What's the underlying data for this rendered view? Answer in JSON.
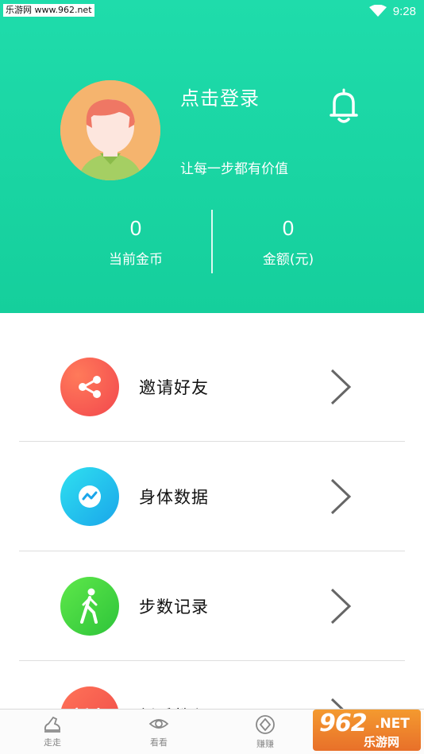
{
  "status_bar": {
    "watermark": "乐游网 www.962.net",
    "time": "9:28"
  },
  "profile": {
    "login_text": "点击登录",
    "slogan": "让每一步都有价值",
    "coins_value": "0",
    "coins_label": "当前金币",
    "amount_value": "0",
    "amount_label": "金额(元)"
  },
  "menu": {
    "items": [
      {
        "label": "邀请好友",
        "icon": "share-icon",
        "color": "#f7554f"
      },
      {
        "label": "身体数据",
        "icon": "chart-icon",
        "color": "#17b7ea"
      },
      {
        "label": "步数记录",
        "icon": "walking-icon",
        "color": "#3ad04a"
      },
      {
        "label": "新手教程",
        "icon": "tutorial-icon",
        "color": "#f2574a"
      }
    ]
  },
  "tabbar": {
    "tabs": [
      {
        "label": "走走",
        "icon": "shoe-icon"
      },
      {
        "label": "看看",
        "icon": "eye-icon"
      },
      {
        "label": "赚赚",
        "icon": "diamond-icon"
      }
    ]
  },
  "watermark_badge": {
    "big": "962",
    "net": ".NET",
    "sub": "乐游网"
  },
  "colors": {
    "header": "#1ad6a4",
    "accent_red": "#f7554f",
    "accent_blue": "#17b7ea",
    "accent_green": "#3ad04a"
  }
}
